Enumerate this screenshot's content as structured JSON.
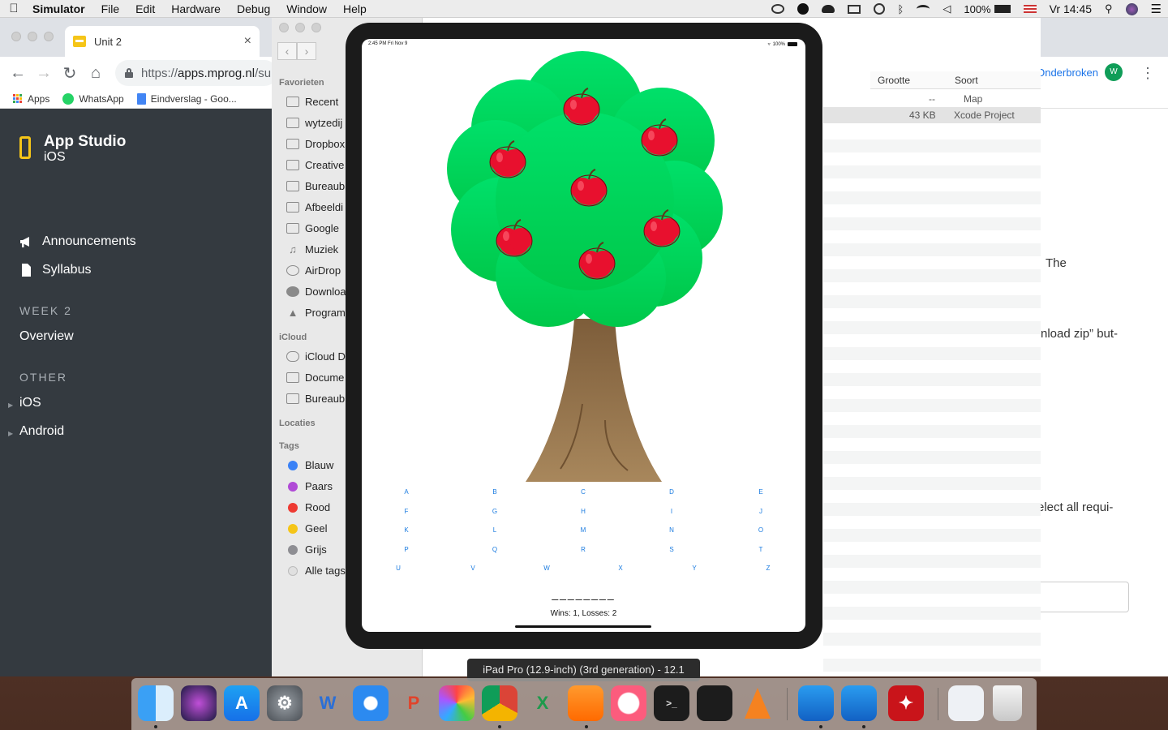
{
  "menubar": {
    "app_name": "Simulator",
    "items": [
      "File",
      "Edit",
      "Hardware",
      "Debug",
      "Window",
      "Help"
    ],
    "battery": "100%",
    "clock": "Vr 14:45"
  },
  "browser": {
    "tab_title": "Unit 2",
    "url_prefix": "https://",
    "url_host": "apps.mprog.nl",
    "url_rest": "/su",
    "profile_label": "Onderbroken",
    "profile_initial": "W",
    "bookmarks": [
      "Apps",
      "WhatsApp",
      "Eindverslag - Goo..."
    ]
  },
  "studio": {
    "title": "App Studio",
    "subtitle": "iOS",
    "nav": [
      "Announcements",
      "Syllabus"
    ],
    "week_heading": "WEEK 2",
    "week_items": [
      "Overview"
    ],
    "other_heading": "OTHER",
    "other_items": [
      "iOS",
      "Android"
    ]
  },
  "finder": {
    "favorites_heading": "Favorieten",
    "favorites": [
      "Recent",
      "wytzedij",
      "Dropbox",
      "Creative",
      "Bureaub",
      "Afbeeldi",
      "Google",
      "Muziek",
      "AirDrop",
      "Downloa",
      "Program"
    ],
    "icloud_heading": "iCloud",
    "icloud": [
      "iCloud D",
      "Docume",
      "Bureaub"
    ],
    "locations_heading": "Locaties",
    "tags_heading": "Tags",
    "tags": [
      {
        "label": "Blauw",
        "color": "#3b82f6"
      },
      {
        "label": "Paars",
        "color": "#b04ad6"
      },
      {
        "label": "Rood",
        "color": "#ee3a32"
      },
      {
        "label": "Geel",
        "color": "#f5c518"
      },
      {
        "label": "Grijs",
        "color": "#8e8e93"
      },
      {
        "label": "Alle tags",
        "color": "#e0e0e0"
      }
    ],
    "col_size": "Grootte",
    "col_kind": "Soort",
    "rows": [
      {
        "size": "--",
        "kind": "Map"
      },
      {
        "size": "43 KB",
        "kind": "Xcode Project"
      }
    ]
  },
  "page_fragments": {
    "line1": "The",
    "line2": "nload zip” but-",
    "line3": "elect all requi-"
  },
  "game": {
    "status_time": "2:45 PM  Fri Nov 9",
    "status_battery": "100%",
    "letters_row1": [
      "A",
      "B",
      "C",
      "D",
      "E"
    ],
    "letters_row2": [
      "F",
      "G",
      "H",
      "I",
      "J"
    ],
    "letters_row3": [
      "K",
      "L",
      "M",
      "N",
      "O"
    ],
    "letters_row4": [
      "P",
      "Q",
      "R",
      "S",
      "T"
    ],
    "letters_row5": [
      "U",
      "V",
      "W",
      "X",
      "Y",
      "Z"
    ],
    "word": "________",
    "score": "Wins: 1, Losses: 2",
    "apple_count": 7
  },
  "simulator_label": "iPad Pro (12.9-inch) (3rd generation) - 12.1",
  "dock": {
    "apps": [
      "finder-icon",
      "siri-icon",
      "app-store-icon",
      "system-preferences-icon",
      "word-icon",
      "safari-icon",
      "powerpoint-icon",
      "photos-icon",
      "chrome-icon",
      "excel-icon",
      "ibooks-icon",
      "itunes-icon",
      "terminal-icon",
      "activity-monitor-icon",
      "vlc-icon",
      "xcode-icon",
      "simulator-icon",
      "acrobat-icon",
      "preview-icon",
      "trash-icon"
    ]
  }
}
